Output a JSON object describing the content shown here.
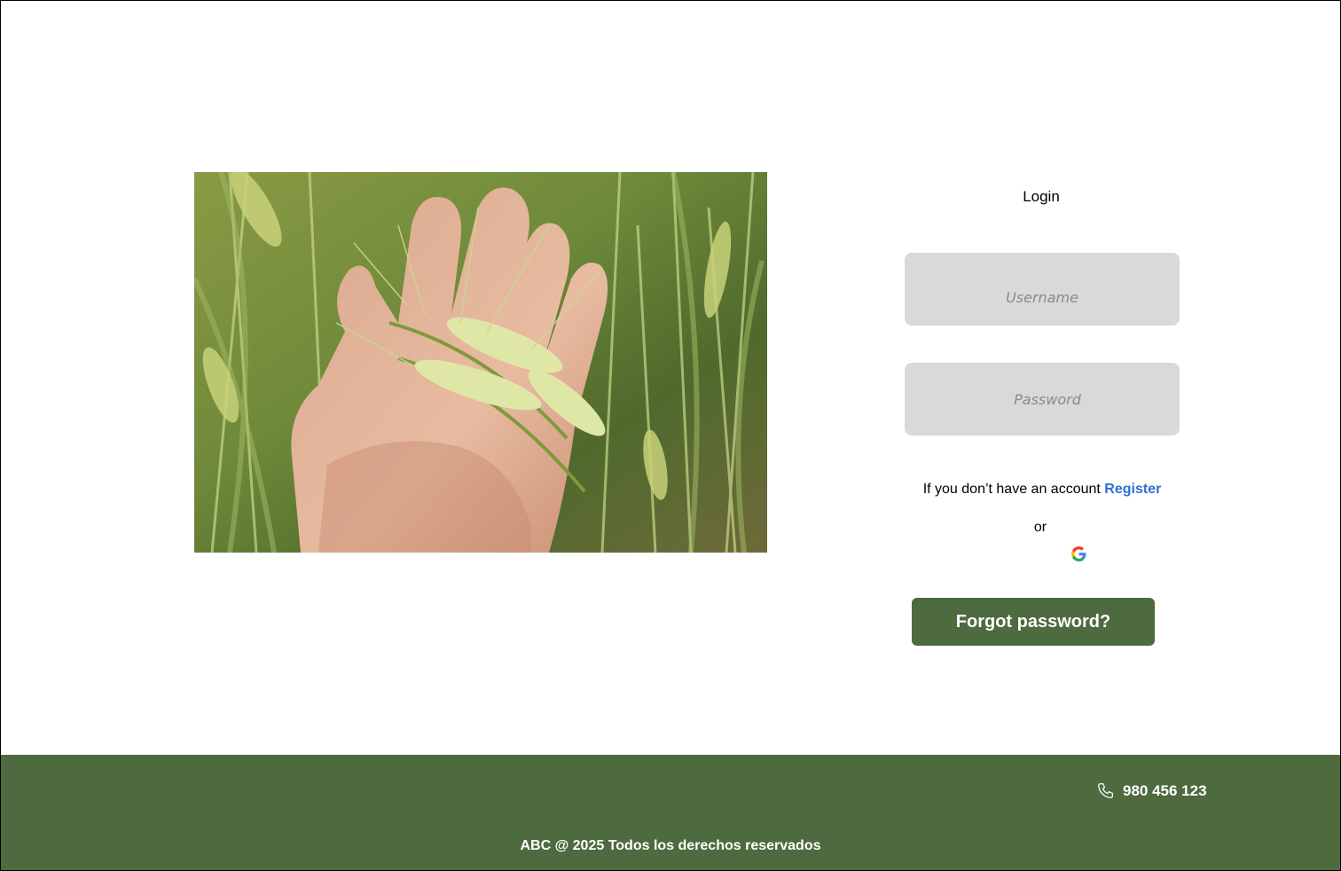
{
  "login": {
    "title": "Login",
    "username_placeholder": "Username",
    "password_placeholder": "Password",
    "register_prompt": "If you don’t have an account",
    "register_link": "Register",
    "or_text": "or",
    "social_icon": "google-icon",
    "forgot_button": "Forgot password?"
  },
  "hero": {
    "image_subject": "hand-holding-wheat"
  },
  "footer": {
    "phone_icon": "phone-icon",
    "phone_number": "980 456 123",
    "copyright": "ABC @ 2025 Todos los derechos reservados"
  },
  "colors": {
    "brand_green": "#4e6a3f",
    "input_bg": "#d9d9d9",
    "link_blue": "#2f6fd0",
    "placeholder_gray": "#8a8a8a"
  }
}
